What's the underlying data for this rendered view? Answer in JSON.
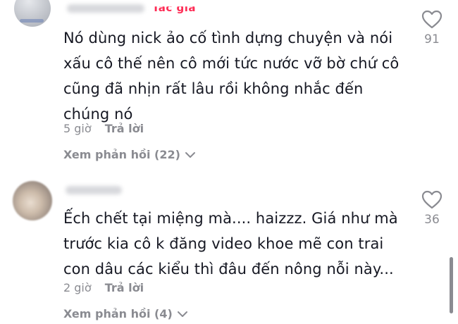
{
  "comments": [
    {
      "author_tag": "Tác giả",
      "text": "Nó dùng nick ảo cố tình dựng chuyện và nói\nxấu cô thế nên cô mới tức nước vỡ bờ chứ cô\ncũng đã nhịn rất lâu rồi không nhắc đến\nchúng nó",
      "time": "5 giờ",
      "reply_label": "Trả lời",
      "view_replies": "Xem phản hồi (22)",
      "like_count": "91"
    },
    {
      "text": "Ếch chết tại miệng mà.... haizzz. Giá như mà\ntrước kia cô k đăng video khoe mẽ con trai\ncon dâu các kiểu thì đâu đến nông nỗi này...",
      "time": "2 giờ",
      "reply_label": "Trả lời",
      "view_replies": "Xem phản hồi (4)",
      "like_count": "36"
    }
  ],
  "icons": {
    "like": "heart-outline-icon",
    "expand": "chevron-down-icon"
  },
  "colors": {
    "author_tag": "#fe2c55",
    "secondary_text": "#8a8b91",
    "primary_text": "#161823"
  }
}
